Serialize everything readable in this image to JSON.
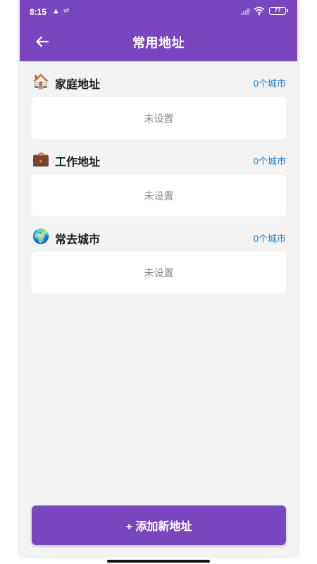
{
  "status_bar": {
    "time": "8:15",
    "battery": "77"
  },
  "header": {
    "title": "常用地址",
    "back_icon": "arrow-left-icon"
  },
  "sections": [
    {
      "emoji": "🏠",
      "icon": "house-icon",
      "title": "家庭地址",
      "count": "0个城市",
      "empty_text": "未设置"
    },
    {
      "emoji": "💼",
      "icon": "briefcase-icon",
      "title": "工作地址",
      "count": "0个城市",
      "empty_text": "未设置"
    },
    {
      "emoji": "🌍",
      "icon": "globe-icon",
      "title": "常去城市",
      "count": "0个城市",
      "empty_text": "未设置"
    }
  ],
  "footer": {
    "add_label": "+ 添加新地址"
  },
  "colors": {
    "primary": "#7a46bd",
    "background": "#f3f3f3",
    "link": "#1e7ec8",
    "muted": "#8a8a8a"
  }
}
